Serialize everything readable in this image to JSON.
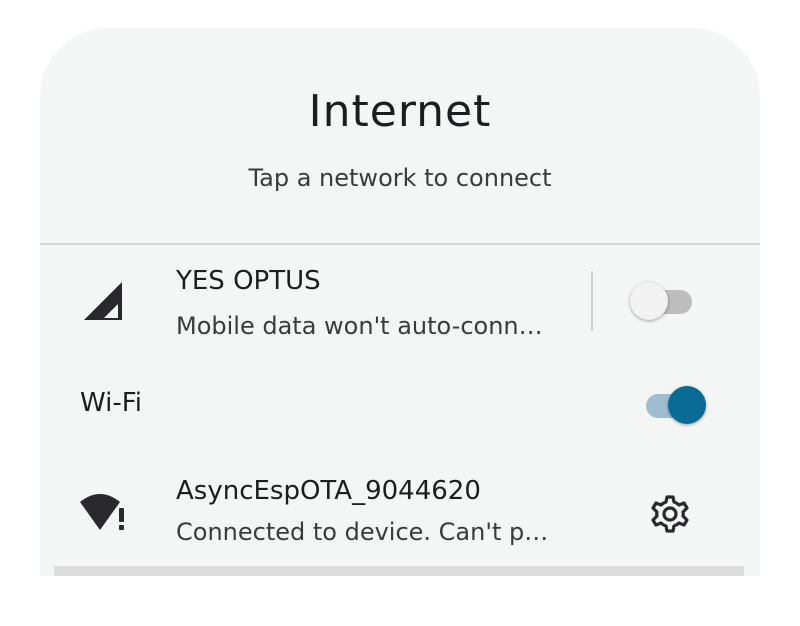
{
  "dialog": {
    "title": "Internet",
    "subtitle": "Tap a network to connect"
  },
  "mobile": {
    "name": "YES OPTUS",
    "status": "Mobile data won't auto-conn…",
    "toggle_on": false,
    "icon": "signal-icon"
  },
  "wifi": {
    "label": "Wi-Fi",
    "toggle_on": true
  },
  "networks": [
    {
      "name": "AsyncEspOTA_9044620",
      "status": "Connected to device. Can't p…",
      "icon": "wifi-warning-icon",
      "settings_icon": "gear-icon"
    }
  ],
  "colors": {
    "accent": "#0a6b96",
    "panel_bg": "#f4f5f5"
  }
}
